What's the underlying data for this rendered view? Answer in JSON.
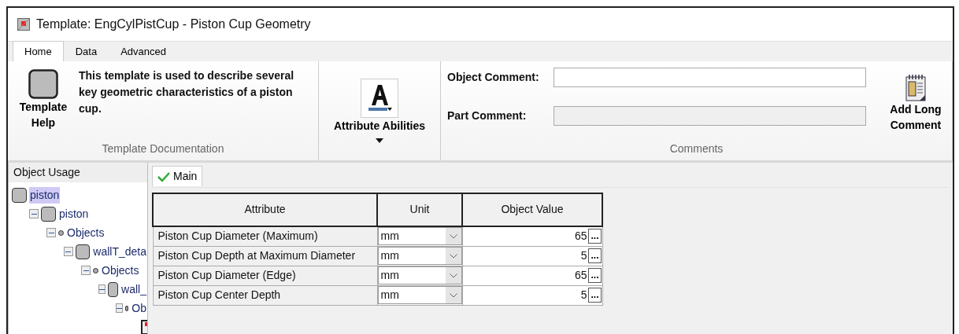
{
  "window": {
    "title": "Template: EngCylPistCup - Piston Cup Geometry"
  },
  "ribbon_tabs": [
    {
      "label": "Home",
      "selected": true
    },
    {
      "label": "Data",
      "selected": false
    },
    {
      "label": "Advanced",
      "selected": false
    }
  ],
  "documentation_group": {
    "button": "Template Help",
    "description": "This template is used to describe several key geometric characteristics of a piston cup.",
    "label": "Template Documentation"
  },
  "attribute_abilities": {
    "button": "Attribute Abilities"
  },
  "comments_group": {
    "object_comment_label": "Object Comment:",
    "part_comment_label": "Part Comment:",
    "part_comment_disabled": true,
    "long_comment_button": "Add Long Comment",
    "label": "Comments"
  },
  "object_usage": {
    "title": "Object Usage",
    "tree": [
      {
        "kind": "object",
        "label": "piston",
        "selected": true,
        "children": [
          {
            "kind": "object",
            "label": "piston",
            "selected": false,
            "expanded": true,
            "children": [
              {
                "kind": "folder",
                "label": "Objects",
                "selected": false,
                "expanded": true,
                "children": [
                  {
                    "kind": "object",
                    "label": "wallT_deta",
                    "selected": false,
                    "expanded": true,
                    "children": [
                      {
                        "kind": "folder",
                        "label": "Objects",
                        "selected": false,
                        "expanded": true,
                        "children": [
                          {
                            "kind": "object",
                            "label": "wall_",
                            "selected": false,
                            "expanded": true,
                            "children": [
                              {
                                "kind": "folder",
                                "label": "Ob",
                                "selected": false,
                                "expanded": true,
                                "children": [
                                  {
                                    "kind": "template"
                                  }
                                ]
                              }
                            ]
                          }
                        ]
                      }
                    ]
                  }
                ]
              }
            ]
          }
        ]
      }
    ]
  },
  "main_tabs": [
    {
      "label": "Main",
      "selected": true
    }
  ],
  "table": {
    "columns": [
      "Attribute",
      "Unit",
      "Object Value"
    ],
    "rows": [
      {
        "attribute": "Piston Cup Diameter (Maximum)",
        "unit": "mm",
        "value": "65",
        "button": "..."
      },
      {
        "attribute": "Piston Cup Depth at Maximum Diameter",
        "unit": "mm",
        "value": "5",
        "button": "..."
      },
      {
        "attribute": "Piston Cup Diameter (Edge)",
        "unit": "mm",
        "value": "65",
        "button": "..."
      },
      {
        "attribute": "Piston Cup Center Depth",
        "unit": "mm",
        "value": "5",
        "button": "..."
      }
    ]
  }
}
